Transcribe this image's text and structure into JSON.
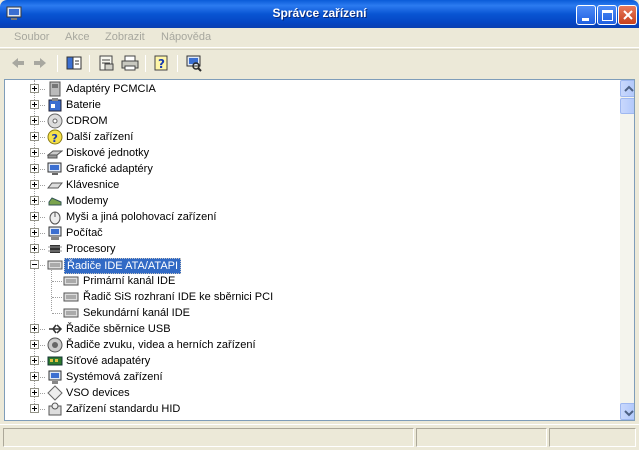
{
  "window": {
    "title": "Správce zařízení"
  },
  "menu": {
    "items": [
      {
        "label": "Soubor"
      },
      {
        "label": "Akce"
      },
      {
        "label": "Zobrazit"
      },
      {
        "label": "Nápověda"
      }
    ]
  },
  "toolbar": {
    "buttons": [
      "back-icon",
      "forward-icon",
      "show-hide-console-tree-icon",
      "properties-icon",
      "print-icon",
      "help-icon",
      "scan-hardware-icon"
    ]
  },
  "tree": {
    "items": [
      {
        "label": "Adaptéry PCMCIA",
        "icon": "pcmcia-icon"
      },
      {
        "label": "Baterie",
        "icon": "battery-icon"
      },
      {
        "label": "CDROM",
        "icon": "cdrom-icon"
      },
      {
        "label": "Další zařízení",
        "icon": "unknown-device-icon"
      },
      {
        "label": "Diskové jednotky",
        "icon": "disk-drive-icon"
      },
      {
        "label": "Grafické adaptéry",
        "icon": "display-adapter-icon"
      },
      {
        "label": "Klávesnice",
        "icon": "keyboard-icon"
      },
      {
        "label": "Modemy",
        "icon": "modem-icon"
      },
      {
        "label": "Myši a jiná polohovací zařízení",
        "icon": "mouse-icon"
      },
      {
        "label": "Počítač",
        "icon": "computer-icon"
      },
      {
        "label": "Procesory",
        "icon": "processor-icon"
      },
      {
        "label": "Řadiče IDE ATA/ATAPI",
        "icon": "ide-controller-icon",
        "selected": true,
        "expanded": true,
        "children": [
          {
            "label": "Primární kanál IDE"
          },
          {
            "label": "Řadič SiS rozhraní IDE ke sběrnici PCI"
          },
          {
            "label": "Sekundární kanál IDE"
          }
        ]
      },
      {
        "label": "Řadiče sběrnice USB",
        "icon": "usb-icon"
      },
      {
        "label": "Řadiče zvuku, videa a herních zařízení",
        "icon": "sound-icon"
      },
      {
        "label": "Síťové adapatéry",
        "icon": "network-adapter-icon"
      },
      {
        "label": "Systémová zařízení",
        "icon": "system-device-icon"
      },
      {
        "label": "VSO devices",
        "icon": "vso-device-icon"
      },
      {
        "label": "Zařízení standardu HID",
        "icon": "hid-icon"
      }
    ]
  }
}
